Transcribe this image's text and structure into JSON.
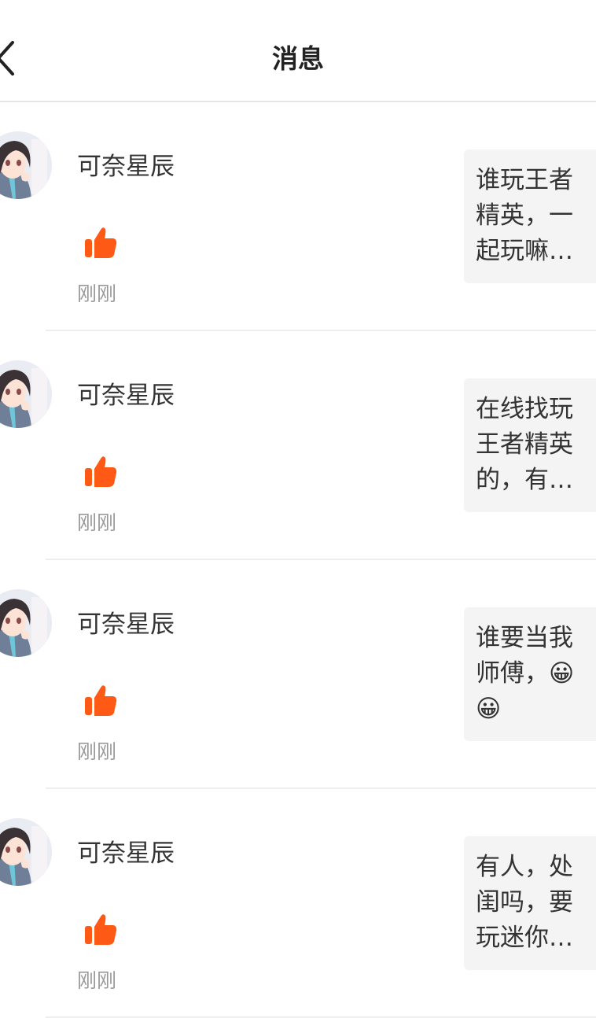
{
  "navbar": {
    "back_icon": "chevron-left-icon",
    "title": "消息"
  },
  "colors": {
    "like": "#fe5a16",
    "timestamp": "#9a9a9a",
    "content_bg": "#f4f4f4",
    "divider": "#eeeeee"
  },
  "messages": [
    {
      "username": "可奈星辰",
      "icon": "thumbs-up-icon",
      "time": "刚刚",
      "content": "谁玩王者精英，一起玩嘛…"
    },
    {
      "username": "可奈星辰",
      "icon": "thumbs-up-icon",
      "time": "刚刚",
      "content": "在线找玩王者精英的，有…"
    },
    {
      "username": "可奈星辰",
      "icon": "thumbs-up-icon",
      "time": "刚刚",
      "content": "谁要当我师傅，😀😀"
    },
    {
      "username": "可奈星辰",
      "icon": "thumbs-up-icon",
      "time": "刚刚",
      "content": "有人，处闺吗，要玩迷你…"
    }
  ]
}
